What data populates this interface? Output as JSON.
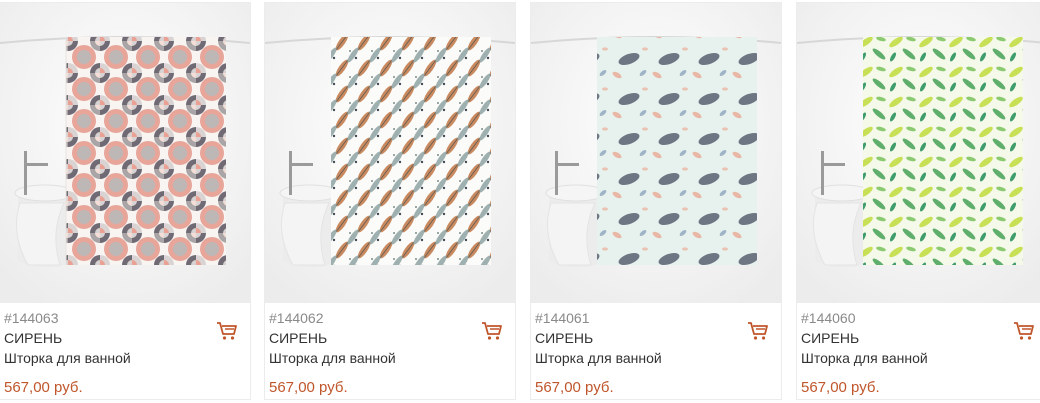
{
  "accent_color": "#c0562b",
  "products": [
    {
      "sku": "#144063",
      "brand": "СИРЕНЬ",
      "name": "Шторка для ванной",
      "price": "567,00 руб.",
      "pattern": "circles",
      "cart_icon": "cart-icon"
    },
    {
      "sku": "#144062",
      "brand": "СИРЕНЬ",
      "name": "Шторка для ванной",
      "price": "567,00 руб.",
      "pattern": "feathers",
      "cart_icon": "cart-icon"
    },
    {
      "sku": "#144061",
      "brand": "СИРЕНЬ",
      "name": "Шторка для ванной",
      "price": "567,00 руб.",
      "pattern": "whales",
      "cart_icon": "cart-icon"
    },
    {
      "sku": "#144060",
      "brand": "СИРЕНЬ",
      "name": "Шторка для ванной",
      "price": "567,00 руб.",
      "pattern": "leaves",
      "cart_icon": "cart-icon"
    }
  ]
}
